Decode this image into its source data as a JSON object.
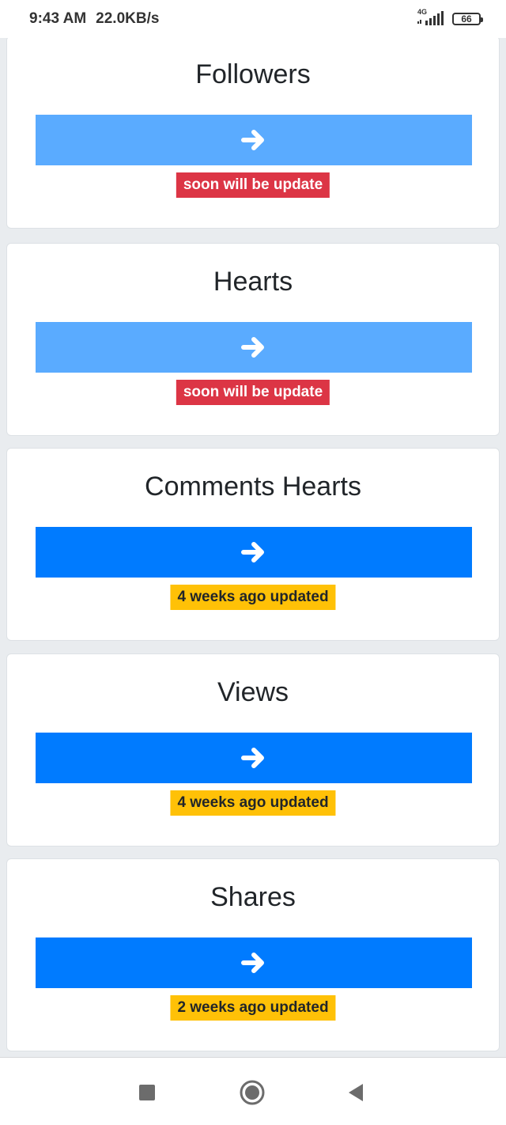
{
  "status_bar": {
    "time": "9:43 AM",
    "speed": "22.0KB/s",
    "network": "4G",
    "battery": "66"
  },
  "cards": [
    {
      "title": "Followers",
      "badge": "soon will be update",
      "badge_color": "#dc3545",
      "button_color": "#5aabff"
    },
    {
      "title": "Hearts",
      "badge": "soon will be update",
      "badge_color": "#dc3545",
      "button_color": "#5aabff"
    },
    {
      "title": "Comments Hearts",
      "badge": "4 weeks ago updated",
      "badge_color": "#ffc107",
      "button_color": "#007bff"
    },
    {
      "title": "Views",
      "badge": "4 weeks ago updated",
      "badge_color": "#ffc107",
      "button_color": "#007bff"
    },
    {
      "title": "Shares",
      "badge": "2 weeks ago updated",
      "badge_color": "#ffc107",
      "button_color": "#007bff"
    }
  ],
  "icons": {
    "button": "arrow-right-icon",
    "nav": [
      "stop-square-icon",
      "home-circle-icon",
      "back-triangle-icon"
    ]
  }
}
